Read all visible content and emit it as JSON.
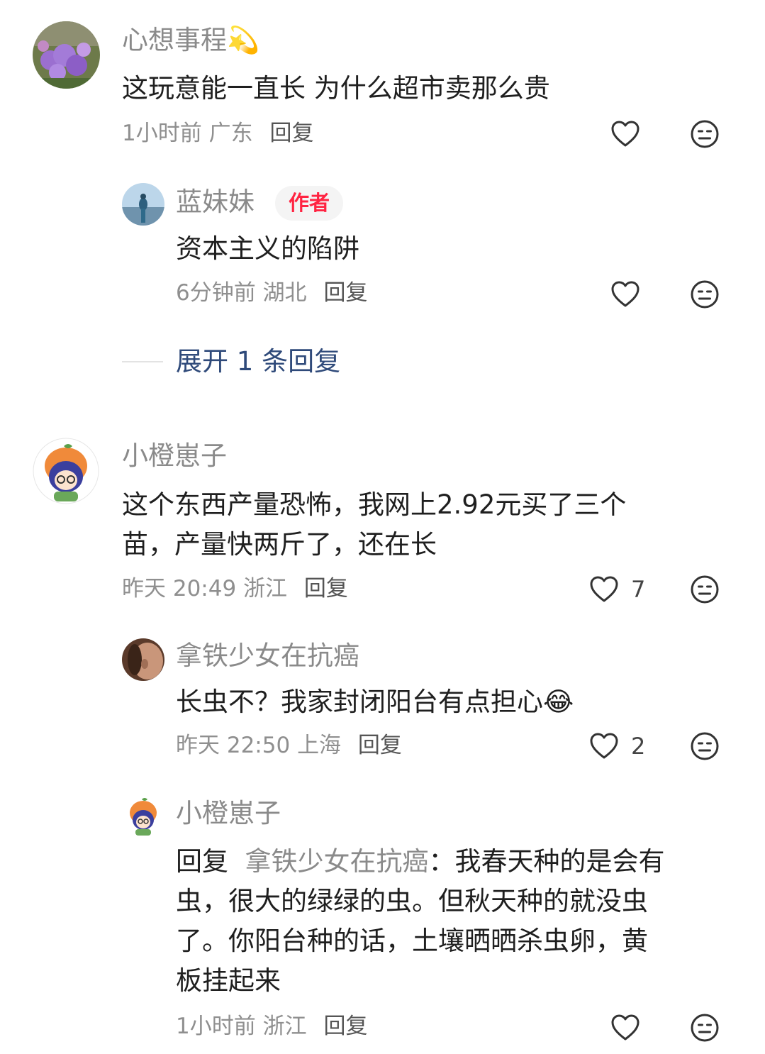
{
  "comments": [
    {
      "name": "心想事程",
      "name_emoji": "💫",
      "text": "这玩意能一直长 为什么超市卖那么贵",
      "time": "1小时前",
      "location": "广东",
      "reply_label": "回复",
      "likes": "",
      "avatar_icon": "purple-flowers-avatar"
    },
    {
      "name": "蓝妹妹",
      "badge": "作者",
      "text": "资本主义的陷阱",
      "time": "6分钟前",
      "location": "湖北",
      "reply_label": "回复",
      "likes": "",
      "avatar_icon": "person-sky-avatar"
    },
    {
      "expand_label": "展开 1 条回复"
    },
    {
      "name": "小橙崽子",
      "text_line1": "这个东西产量恐怖，我网上2.92元买了三个",
      "text_line2": "苗，产量快两斤了，还在长",
      "time": "昨天 20:49",
      "location": "浙江",
      "reply_label": "回复",
      "likes": "7",
      "avatar_icon": "orange-cartoon-avatar"
    },
    {
      "name": "拿铁少女在抗癌",
      "text": "长虫不？我家封闭阳台有点担心",
      "text_emoji": "😂",
      "time": "昨天 22:50",
      "location": "上海",
      "reply_label": "回复",
      "likes": "2",
      "avatar_icon": "portrait-avatar"
    },
    {
      "name": "小橙崽子",
      "reply_prefix": "回复",
      "reply_to": "拿铁少女在抗癌",
      "reply_colon": "：",
      "line1": "我春天种的是会有",
      "line2": "虫，很大的绿绿的虫。但秋天种的就没虫",
      "line3": "了。你阳台种的话，土壤晒晒杀虫卵，黄",
      "line4": "板挂起来",
      "time": "1小时前",
      "location": "浙江",
      "reply_label": "回复",
      "likes": "",
      "avatar_icon": "orange-cartoon-avatar"
    }
  ]
}
